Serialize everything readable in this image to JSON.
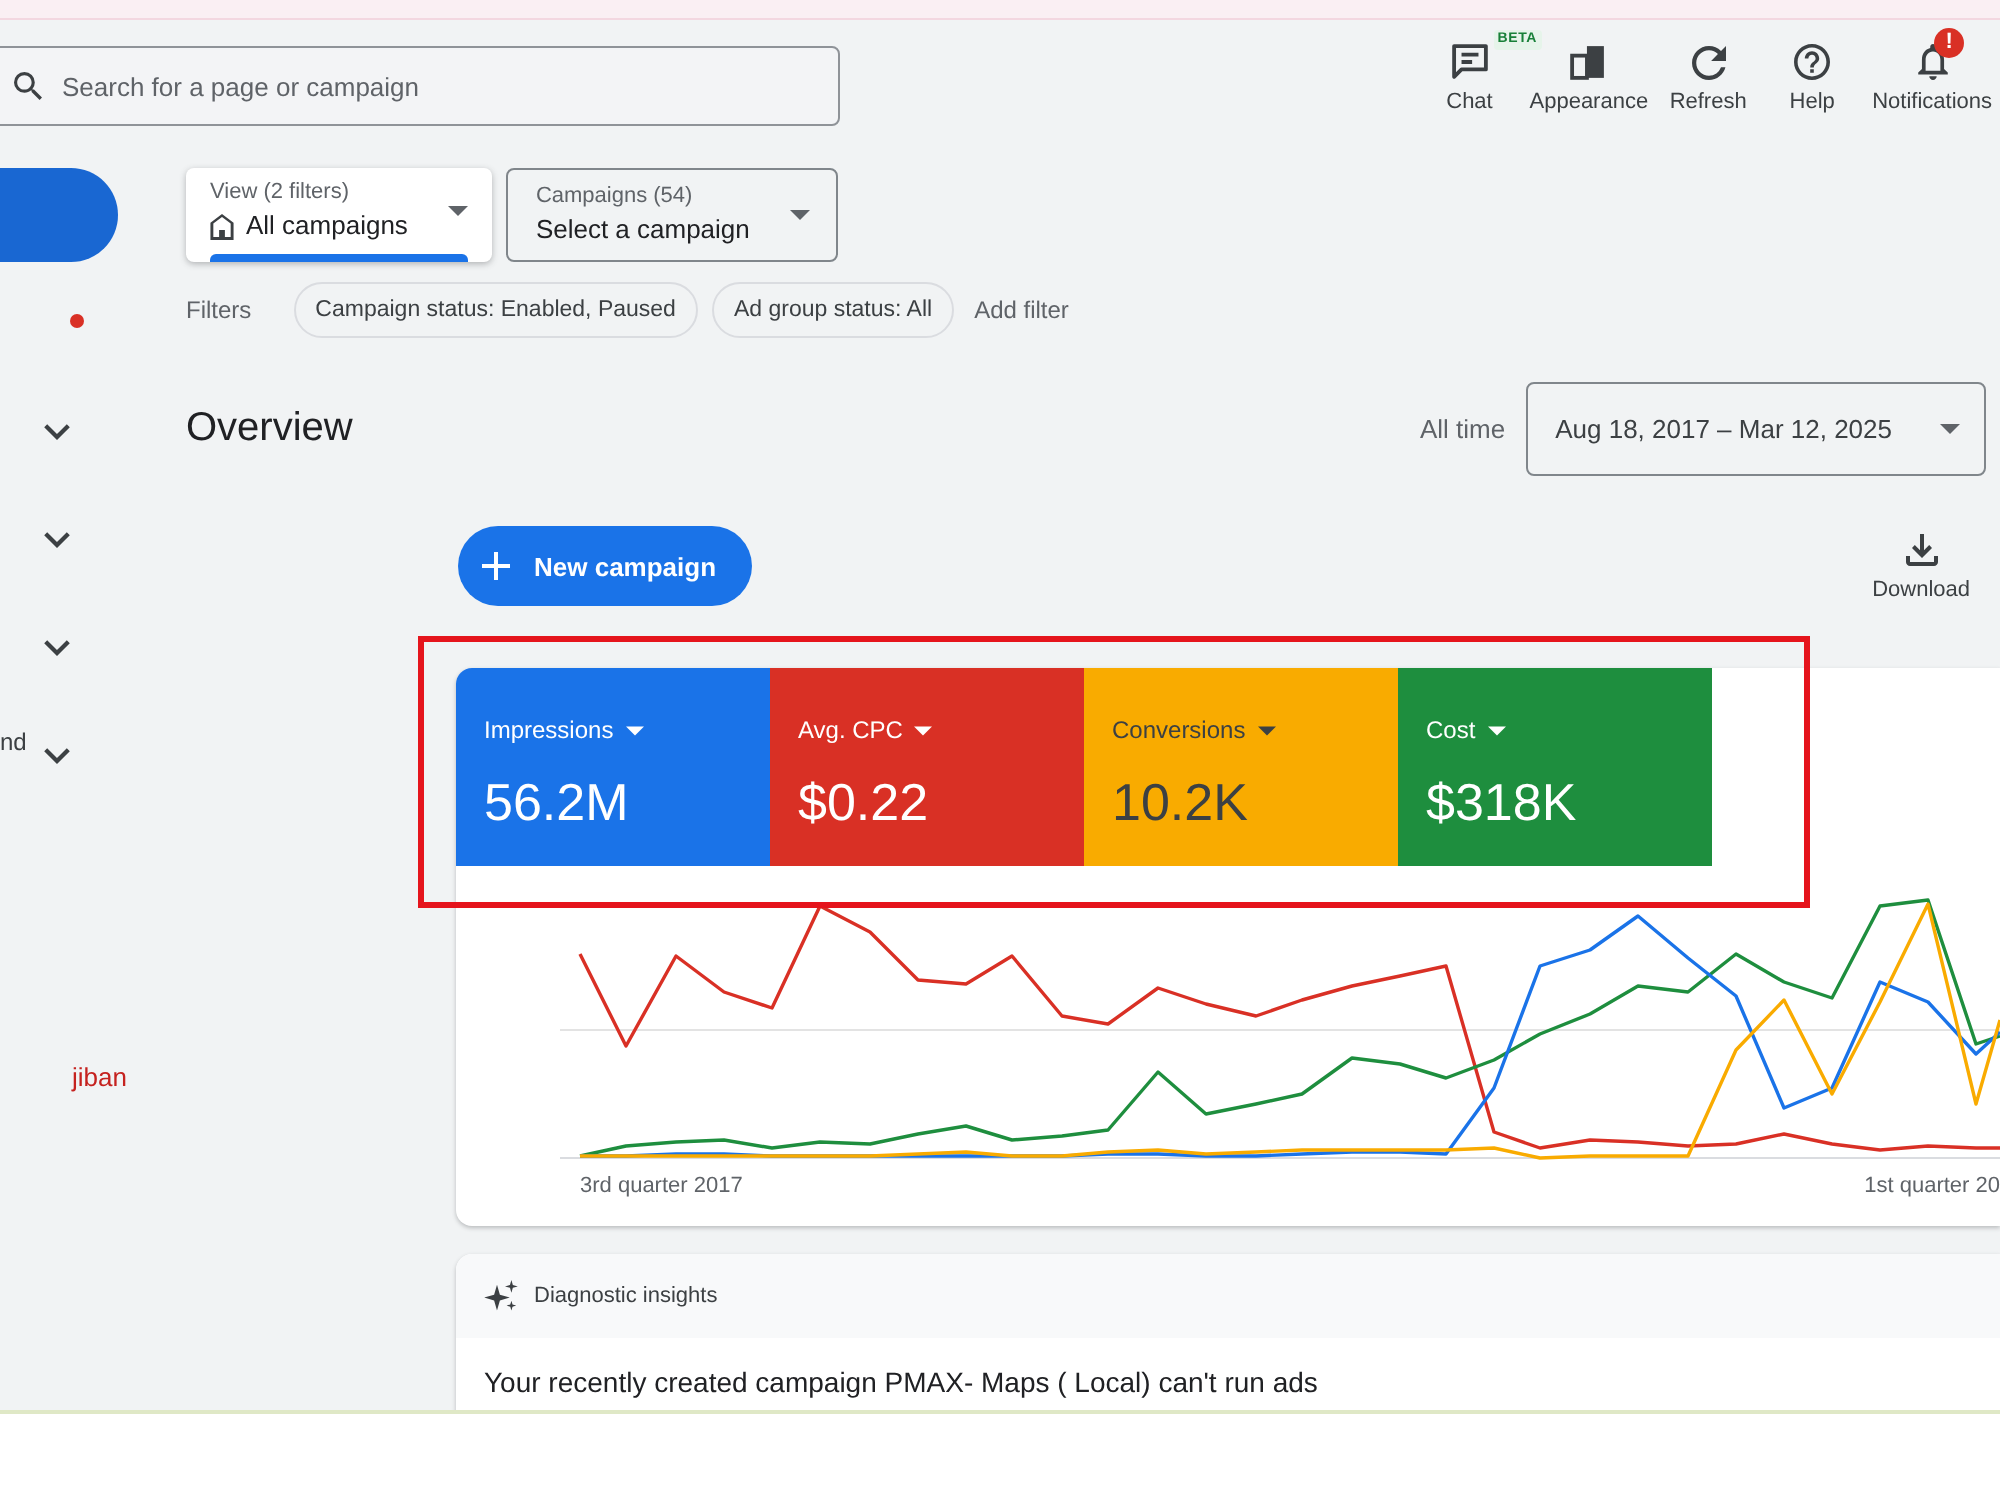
{
  "search": {
    "placeholder": "Search for a page or campaign"
  },
  "toolbar": [
    {
      "kind": "chat",
      "label": "Chat",
      "badge": "BETA"
    },
    {
      "kind": "appearance",
      "label": "Appearance"
    },
    {
      "kind": "refresh",
      "label": "Refresh"
    },
    {
      "kind": "help",
      "label": "Help"
    },
    {
      "kind": "notifications",
      "label": "Notifications",
      "badge": "!"
    }
  ],
  "sidebar": {
    "items": [
      {
        "kind": "button"
      },
      {
        "kind": "dot"
      },
      {
        "kind": "section",
        "expanded": false
      },
      {
        "kind": "section",
        "expanded": false
      },
      {
        "kind": "section",
        "expanded": false
      },
      {
        "kind": "section",
        "label": "nd",
        "expanded": false
      }
    ],
    "note": "jiban"
  },
  "selectors": [
    {
      "kind": "view",
      "label": "View (2 filters)",
      "value": "All campaigns",
      "selected": true
    },
    {
      "kind": "campaigns",
      "label": "Campaigns (54)",
      "value": "Select a campaign",
      "selected": false
    }
  ],
  "filters": {
    "label": "Filters",
    "chips": [
      "Campaign status: Enabled, Paused",
      "Ad group status: All"
    ],
    "add_filter": "Add filter"
  },
  "overview": {
    "title": "Overview",
    "range_label": "All time",
    "date_range": "Aug 18, 2017 – Mar 12, 2025",
    "new_campaign": "New campaign",
    "download": "Download"
  },
  "metrics": [
    {
      "name": "Impressions",
      "value": "56.2M",
      "color": "#1a73e8"
    },
    {
      "name": "Avg. CPC",
      "value": "$0.22",
      "color": "#d93025"
    },
    {
      "name": "Conversions",
      "value": "10.2K",
      "color": "#f9ab00"
    },
    {
      "name": "Cost",
      "value": "$318K",
      "color": "#1e8e3e"
    }
  ],
  "metrics_highlighted": true,
  "chart": {
    "x_labels": [
      "3rd quarter 2017",
      "1st quarter 20"
    ]
  },
  "insights": {
    "title": "Diagnostic insights",
    "message": "Your recently created campaign PMAX- Maps ( Local) can't run ads"
  }
}
